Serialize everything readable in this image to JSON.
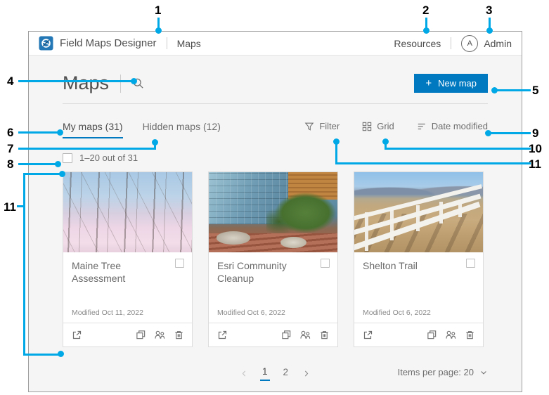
{
  "header": {
    "brand": "Field Maps Designer",
    "nav_maps": "Maps",
    "resources": "Resources",
    "avatar_initial": "A",
    "user_name": "Admin"
  },
  "page": {
    "title": "Maps",
    "new_map_plus": "+",
    "new_map_label": "New map"
  },
  "tabs": {
    "my_maps": "My maps (31)",
    "hidden_maps": "Hidden maps (12)",
    "active_tab": "My maps (31)"
  },
  "toolbar": {
    "filter_label": "Filter",
    "view_label": "Grid",
    "sort_label": "Date modified"
  },
  "selection": {
    "checkbox_checked": false,
    "count_label": "1–20 out of 31"
  },
  "cards": [
    {
      "title": "Maine Tree Assessment",
      "modified": "Modified Oct 11, 2022",
      "checkbox_checked": false
    },
    {
      "title": "Esri Community Cleanup",
      "modified": "Modified Oct 6, 2022",
      "checkbox_checked": false
    },
    {
      "title": "Shelton Trail",
      "modified": "Modified Oct 6, 2022",
      "checkbox_checked": false
    }
  ],
  "pagination": {
    "pages": [
      "1",
      "2"
    ],
    "active_page": "1"
  },
  "items_per_page_label": "Items per page: 20",
  "annotations": {
    "labels": [
      "1",
      "2",
      "3",
      "4",
      "5",
      "6",
      "7",
      "8",
      "9",
      "10",
      "11",
      "11"
    ]
  },
  "colors": {
    "brand_blue": "#0079c1",
    "callout_blue": "#00a9e6",
    "esri_logo_blue": "#2478b6"
  },
  "icons": {
    "logo": "esri-logo",
    "search": "magnifier",
    "new_map": "plus",
    "filter": "funnel",
    "view": "grid-2x2",
    "sort": "sort-descending-lines",
    "card_open": "launch-arrow",
    "card_duplicate": "copy-overlapping-squares",
    "card_share": "people-group",
    "card_delete": "trash-can",
    "page_prev": "chevron-left",
    "page_next": "chevron-right",
    "items_per_page": "chevron-down",
    "avatar": "initial-circle"
  }
}
